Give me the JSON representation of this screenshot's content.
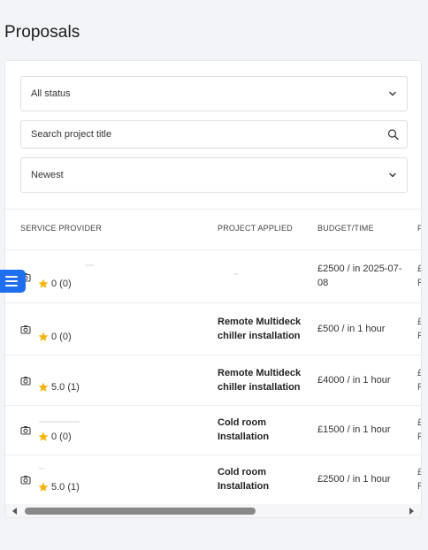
{
  "page": {
    "title": "Proposals"
  },
  "filters": {
    "status": {
      "value": "All status",
      "icon": "chevron-down-icon"
    },
    "search": {
      "placeholder": "Search project title",
      "icon": "search-icon"
    },
    "sort": {
      "value": "Newest",
      "icon": "chevron-down-icon"
    }
  },
  "table": {
    "columns": [
      "SERVICE PROVIDER",
      "PROJECT APPLIED",
      "BUDGET/TIME",
      "P"
    ],
    "rows": [
      {
        "rating": "0 (0)",
        "project": "",
        "budget": "£2500 / in 2025-07-08",
        "edge1": "£",
        "edge2": "F"
      },
      {
        "rating": "0 (0)",
        "project": "Remote Multideck chiller installation",
        "budget": "£500 / in 1 hour",
        "edge1": "£",
        "edge2": "F"
      },
      {
        "rating": "5.0 (1)",
        "project": "Remote Multideck chiller installation",
        "budget": "£4000 / in 1 hour",
        "edge1": "£",
        "edge2": "F"
      },
      {
        "rating": "0 (0)",
        "project": "Cold room Installation",
        "budget": "£1500 / in 1 hour",
        "edge1": "£",
        "edge2": "F"
      },
      {
        "rating": "5.0 (1)",
        "project": "Cold room Installation",
        "budget": "£2500 / in 1 hour",
        "edge1": "£",
        "edge2": "F"
      }
    ]
  },
  "colors": {
    "accent": "#1e6ff0",
    "star": "#f5b50a",
    "background": "#f3f4f8"
  }
}
